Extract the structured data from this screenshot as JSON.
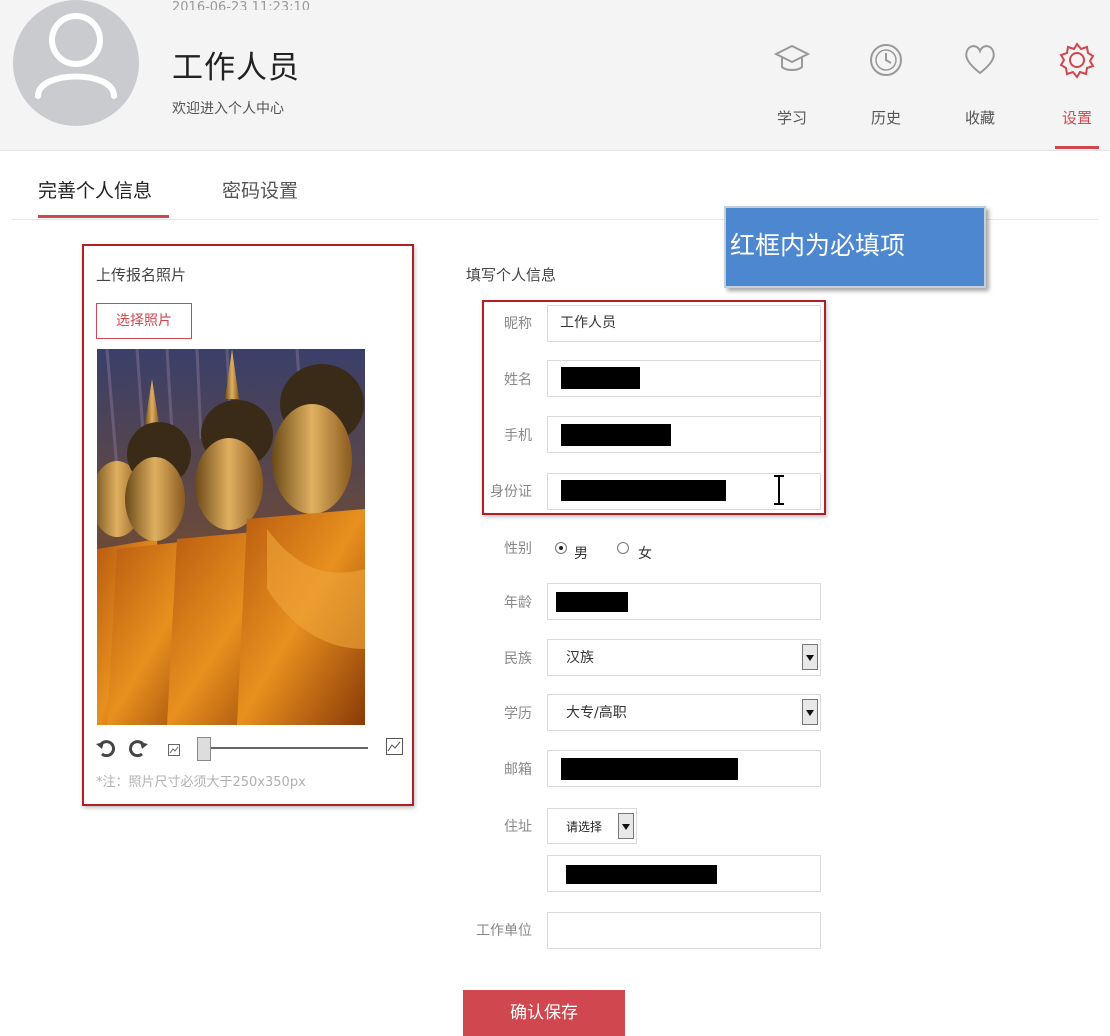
{
  "header": {
    "date": "2016-06-23 11:23:10",
    "user_name": "工作人员",
    "welcome": "欢迎进入个人中心",
    "nav": [
      {
        "label": "学习",
        "icon": "graduation-cap-icon"
      },
      {
        "label": "历史",
        "icon": "clock-icon"
      },
      {
        "label": "收藏",
        "icon": "heart-icon"
      },
      {
        "label": "设置",
        "icon": "gear-icon",
        "active": true
      }
    ]
  },
  "tabs": [
    {
      "label": "完善个人信息",
      "active": true
    },
    {
      "label": "密码设置",
      "active": false
    }
  ],
  "photo": {
    "title": "上传报名照片",
    "choose_label": "选择照片",
    "note": "*注：照片尺寸必须大于250x350px"
  },
  "form": {
    "title": "填写个人信息",
    "callout": "红框内为必填项",
    "labels": {
      "nickname": "昵称",
      "name": "姓名",
      "phone": "手机",
      "id_card": "身份证",
      "gender": "性别",
      "age": "年龄",
      "ethnicity": "民族",
      "education": "学历",
      "email": "邮箱",
      "address": "住址",
      "employer": "工作单位"
    },
    "values": {
      "nickname": "工作人员",
      "gender_male": "男",
      "gender_female": "女",
      "ethnicity": "汉族",
      "education": "大专/高职",
      "address_select": "请选择"
    },
    "save_label": "确认保存"
  },
  "colors": {
    "accent": "#d0474f",
    "required_border": "#b11e24",
    "callout_bg": "#4d87cf"
  }
}
